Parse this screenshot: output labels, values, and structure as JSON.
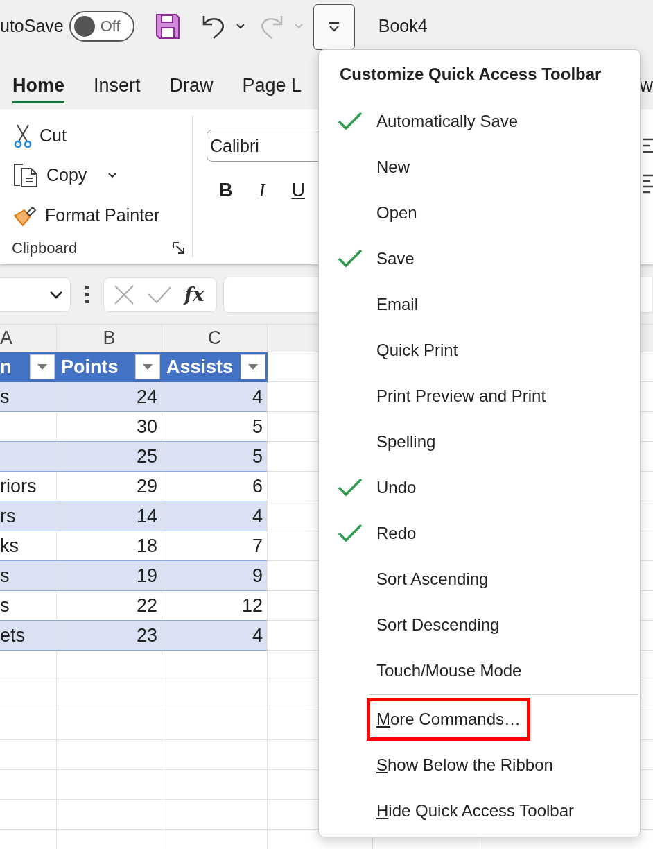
{
  "title_bar": {
    "autosave": {
      "label": "utoSave",
      "on": false,
      "state_text": "Off"
    },
    "quick_access": [
      {
        "kind": "save",
        "disabled": false
      },
      {
        "kind": "undo",
        "disabled": false
      },
      {
        "kind": "dropdown",
        "disabled": false
      },
      {
        "kind": "redo",
        "disabled": true
      },
      {
        "kind": "dropdown",
        "disabled": true
      }
    ],
    "customize_button": {
      "expanded": true
    },
    "document_title": "Book4"
  },
  "tabs": [
    {
      "label": "Home",
      "selected": true
    },
    {
      "label": "Insert",
      "selected": false
    },
    {
      "label": "Draw",
      "selected": false
    },
    {
      "label": "Page L",
      "selected": false
    },
    {
      "label": "w",
      "selected": false
    }
  ],
  "ribbon": {
    "clipboard": {
      "items": [
        {
          "kind": "cut",
          "label": "Cut"
        },
        {
          "kind": "copy",
          "label": "Copy"
        },
        {
          "kind": "painter",
          "label": "Format Painter"
        }
      ],
      "group_label": "Clipboard"
    },
    "font": {
      "font_name": "Calibri",
      "styles": [
        {
          "kind": "bold",
          "label": "B"
        },
        {
          "kind": "italic",
          "label": "I"
        },
        {
          "kind": "underline",
          "label": "U"
        }
      ]
    }
  },
  "formula_bar": {
    "fx": "fx"
  },
  "sheet": {
    "column_headers": [
      "A",
      "B",
      "C"
    ],
    "table": {
      "columns": [
        "n",
        "Points",
        "Assists"
      ],
      "rows": [
        {
          "column_1": "s",
          "points": "24",
          "assists": "4"
        },
        {
          "points": "30",
          "assists": "5"
        },
        {
          "points": "25",
          "assists": "5"
        },
        {
          "column_1": "riors",
          "points": "29",
          "assists": "6"
        },
        {
          "column_1": "rs",
          "points": "14",
          "assists": "4"
        },
        {
          "column_1": "ks",
          "points": "18",
          "assists": "7"
        },
        {
          "column_1": "s",
          "points": "19",
          "assists": "9"
        },
        {
          "column_1": "s",
          "points": "22",
          "assists": "12"
        },
        {
          "column_1": "ets",
          "points": "23",
          "assists": "4"
        }
      ]
    }
  },
  "menu": {
    "title": "Customize Quick Access Toolbar",
    "items": [
      {
        "label": "Automatically Save",
        "checked": true
      },
      {
        "label": "New",
        "checked": false
      },
      {
        "label": "Open",
        "checked": false
      },
      {
        "label": "Save",
        "checked": true
      },
      {
        "label": "Email",
        "checked": false
      },
      {
        "label": "Quick Print",
        "checked": false
      },
      {
        "label": "Print Preview and Print",
        "checked": false
      },
      {
        "label": "Spelling",
        "checked": false
      },
      {
        "label": "Undo",
        "checked": true
      },
      {
        "label": "Redo",
        "checked": true
      },
      {
        "label": "Sort Ascending",
        "checked": false
      },
      {
        "label": "Sort Descending",
        "checked": false
      },
      {
        "label": "Touch/Mouse Mode",
        "checked": false
      }
    ],
    "commands": [
      {
        "accel": "M",
        "rest": "ore Commands…",
        "highlighted": true
      },
      {
        "accel": "S",
        "rest": "how Below the Ribbon",
        "highlighted": false
      },
      {
        "accel": "H",
        "rest": "ide Quick Access Toolbar",
        "highlighted": false
      }
    ]
  }
}
